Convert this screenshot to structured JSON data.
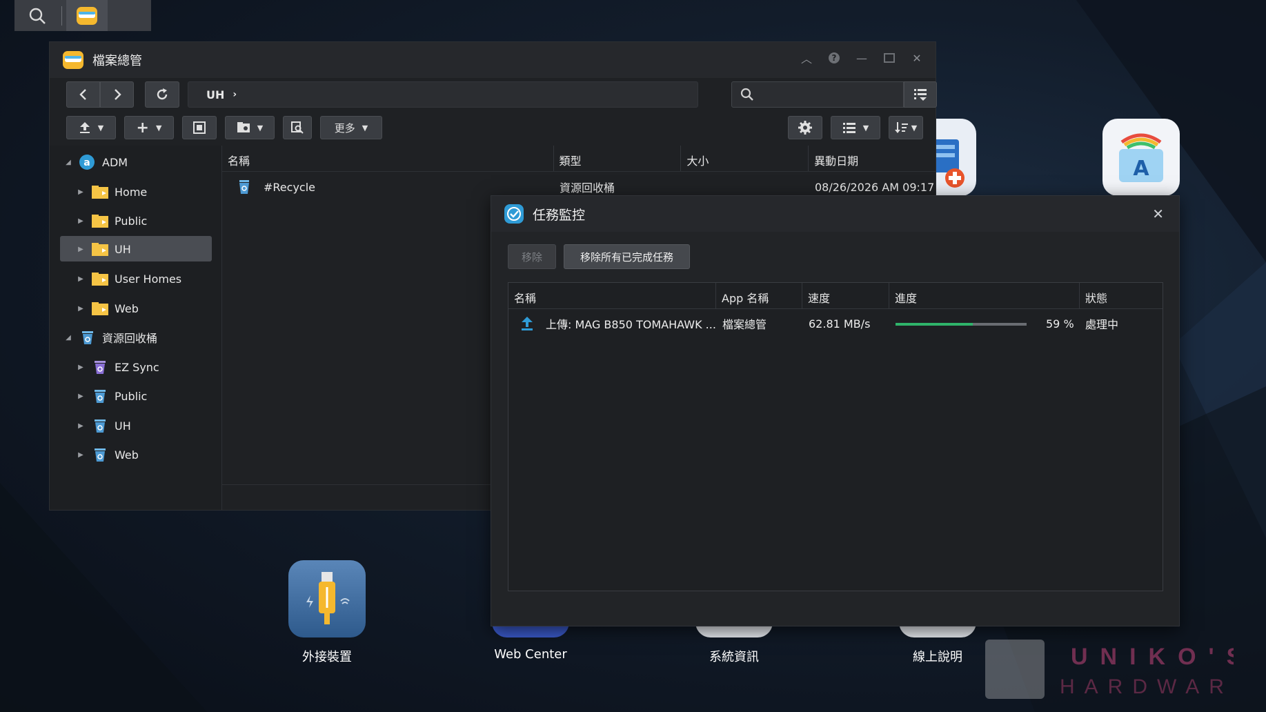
{
  "taskbar": {
    "search_icon": "search-icon",
    "app_icon": "file-manager-icon"
  },
  "file_manager": {
    "title": "檔案總管",
    "path": "UH",
    "toolbar": {
      "more_label": "更多"
    },
    "sidebar": {
      "groups": [
        {
          "label": "ADM",
          "items": [
            "Home",
            "Public",
            "UH",
            "User Homes",
            "Web"
          ],
          "selected": "UH"
        },
        {
          "label": "資源回收桶",
          "items": [
            "EZ Sync",
            "Public",
            "UH",
            "Web"
          ]
        }
      ]
    },
    "columns": [
      "名稱",
      "類型",
      "大小",
      "異動日期"
    ],
    "rows": [
      {
        "name": "#Recycle",
        "type": "資源回收桶",
        "size": "",
        "modified": "08/26/2026 AM 09:17"
      }
    ]
  },
  "task_monitor": {
    "title": "任務監控",
    "remove_label": "移除",
    "remove_all_label": "移除所有已完成任務",
    "columns": [
      "名稱",
      "App 名稱",
      "速度",
      "進度",
      "狀態"
    ],
    "tasks": [
      {
        "name": "上傳: MAG B850 TOMAHAWK ...",
        "app": "檔案總管",
        "speed": "62.81 MB/s",
        "progress": 59,
        "progress_label": "59 %",
        "status": "處理中"
      }
    ]
  },
  "desktop_icons": [
    {
      "label": "外接裝置",
      "icon": "usb-device-icon"
    },
    {
      "label": "Web Center",
      "icon": "web-center-icon"
    },
    {
      "label": "系統資訊",
      "icon": "system-info-icon"
    },
    {
      "label": "線上說明",
      "icon": "online-help-icon"
    }
  ],
  "watermark": {
    "line1": "UNIKO'S",
    "line2": "HARDWARE"
  },
  "colors": {
    "accent": "#2f9bd6",
    "progress": "#2fb36a",
    "selected": "#4a4d53"
  }
}
